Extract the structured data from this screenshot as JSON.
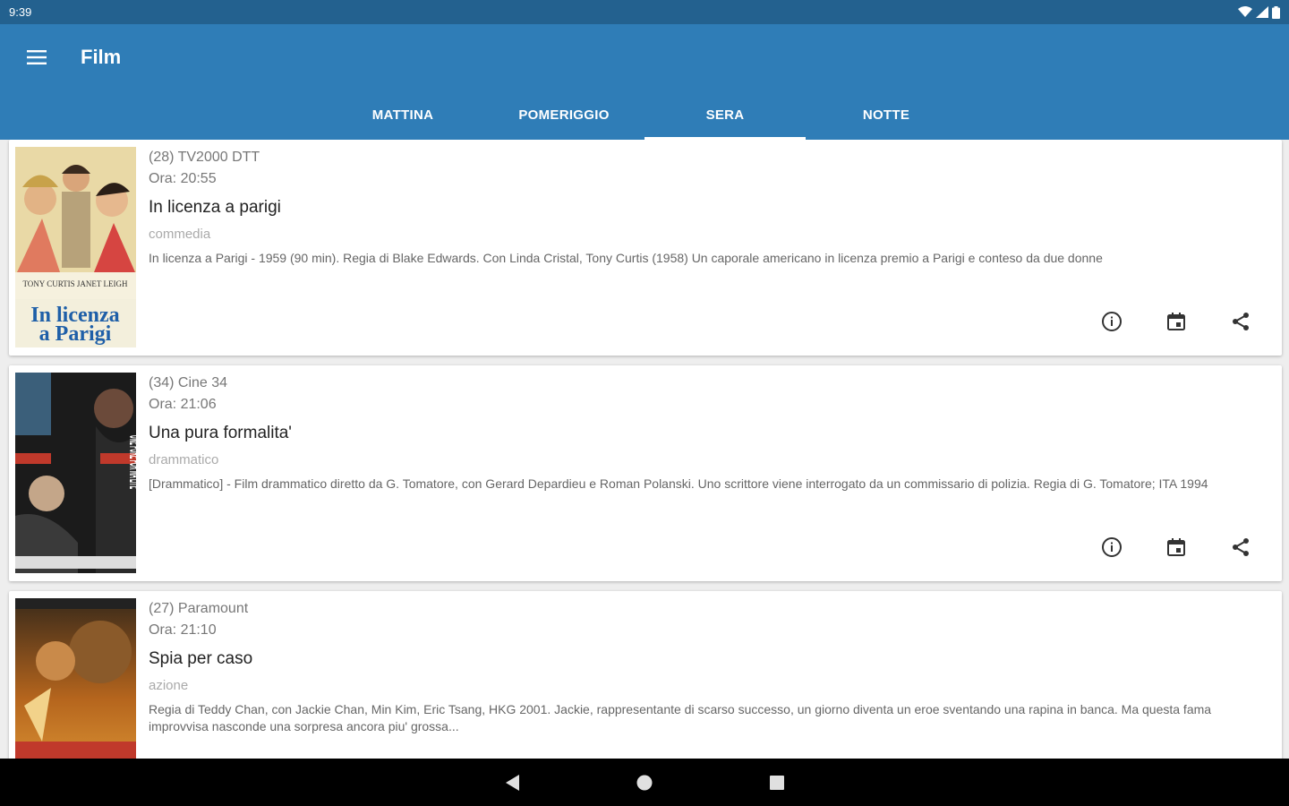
{
  "status_bar": {
    "time": "9:39",
    "icons": [
      "wifi-icon",
      "signal-icon",
      "battery-icon"
    ]
  },
  "app_bar": {
    "title": "Film",
    "menu_icon": "hamburger-menu-icon"
  },
  "tabs": [
    {
      "label": "MATTINA",
      "active": false
    },
    {
      "label": "POMERIGGIO",
      "active": false
    },
    {
      "label": "SERA",
      "active": true
    },
    {
      "label": "NOTTE",
      "active": false
    }
  ],
  "films": [
    {
      "channel": "(28) TV2000 DTT",
      "time": "Ora: 20:55",
      "title": "In licenza a parigi",
      "genre": "commedia",
      "description": "In licenza a Parigi - 1959 (90 min). Regia di Blake Edwards. Con Linda Cristal, Tony Curtis (1958) Un caporale americano in licenza premio a Parigi e conteso da due donne",
      "poster_text_1": "TONY CURTIS   JANET LEIGH",
      "poster_text_2": "In licenza",
      "poster_text_3": "a   Parigi"
    },
    {
      "channel": "(34) Cine 34",
      "time": "Ora: 21:06",
      "title": "Una pura formalita'",
      "genre": "drammatico",
      "description": "[Drammatico] - Film drammatico diretto da G. Tomatore, con Gerard Depardieu e Roman Polanski. Uno scrittore viene interrogato da un commissario di polizia. Regia di G. Tomatore; ITA 1994",
      "poster_text_1": "UNE PURE FOR MA LITE"
    },
    {
      "channel": "(27) Paramount",
      "time": "Ora: 21:10",
      "title": "Spia per caso",
      "genre": "azione",
      "description": "Regia di Teddy Chan, con Jackie Chan, Min Kim, Eric Tsang, HKG 2001. Jackie, rappresentante di scarso successo, un giorno diventa un eroe sventando una rapina in banca. Ma questa fama improvvisa nasconde una sorpresa ancora piu' grossa..."
    }
  ],
  "card_actions": [
    "info-icon",
    "calendar-icon",
    "share-icon"
  ],
  "colors": {
    "status_bar": "#23618f",
    "app_bar": "#2f7db7",
    "background": "#eeeeee"
  }
}
